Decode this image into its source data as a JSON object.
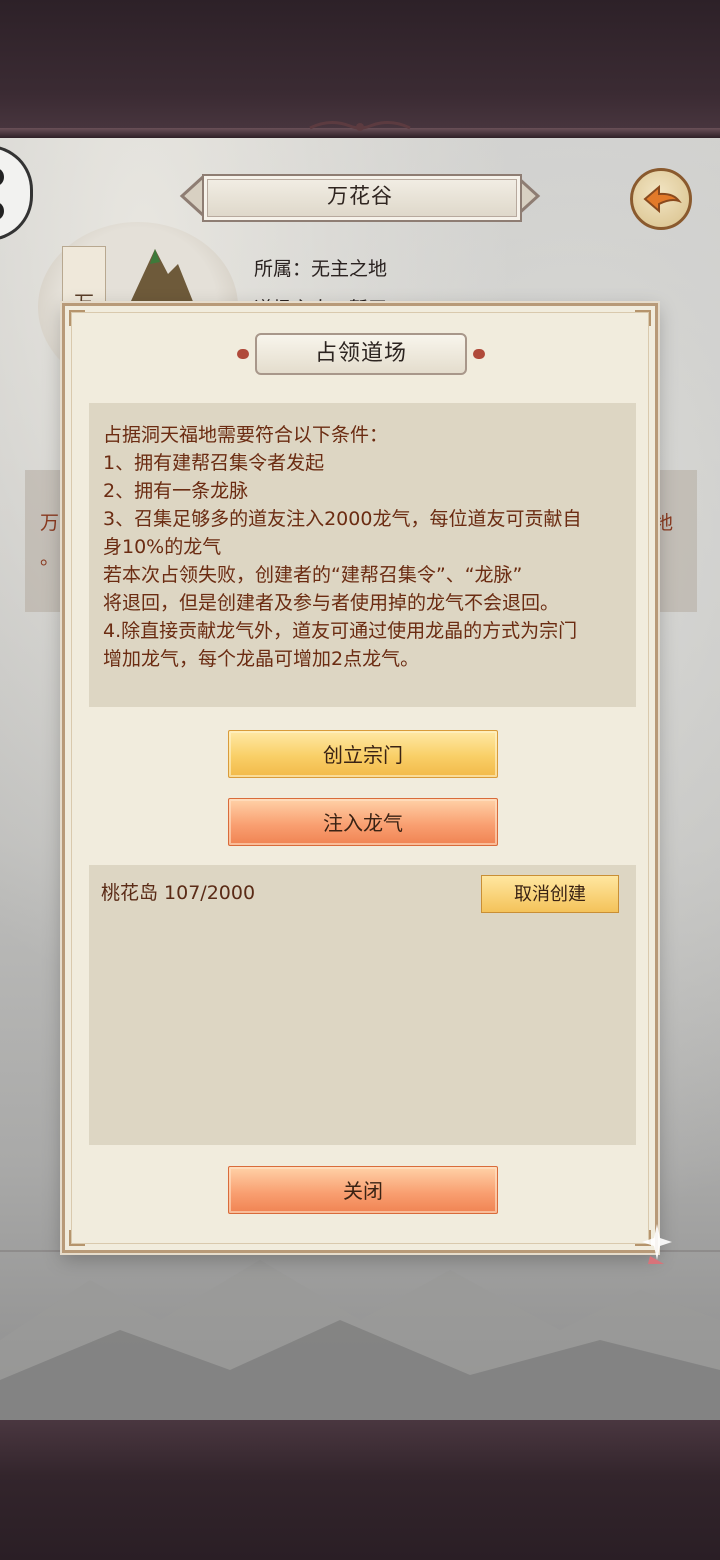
{
  "page": {
    "title": "万花谷",
    "owner_label": "所属：无主之地",
    "leader_label_partial": "道场主人：暂无",
    "avatar_scroll_char": "万",
    "background_text_left": "万",
    "background_text_left2": "。",
    "background_text_right": "地"
  },
  "dialog": {
    "title": "占领道场",
    "rules": [
      "占据洞天福地需要符合以下条件：",
      "1、拥有建帮召集令者发起",
      "2、拥有一条龙脉",
      "3、召集足够多的道友注入2000龙气，每位道友可贡献自",
      "身10%的龙气",
      "若本次占领失败，创建者的“建帮召集令”、“龙脉”",
      "将退回，但是创建者及参与者使用掉的龙气不会退回。",
      "4.除直接贡献龙气外，道友可通过使用龙晶的方式为宗门",
      "增加龙气，每个龙晶可增加2点龙气。"
    ],
    "create_sect_label": "创立宗门",
    "inject_qi_label": "注入龙气",
    "entries": [
      {
        "name_progress": "桃花岛 107/2000",
        "cancel_label": "取消创建"
      }
    ],
    "close_label": "关闭"
  },
  "colors": {
    "rule_text": "#6b2c12",
    "gold_button": "#f9cf67",
    "orange_button": "#f9a072",
    "dialog_bg": "#f1ecdd"
  }
}
